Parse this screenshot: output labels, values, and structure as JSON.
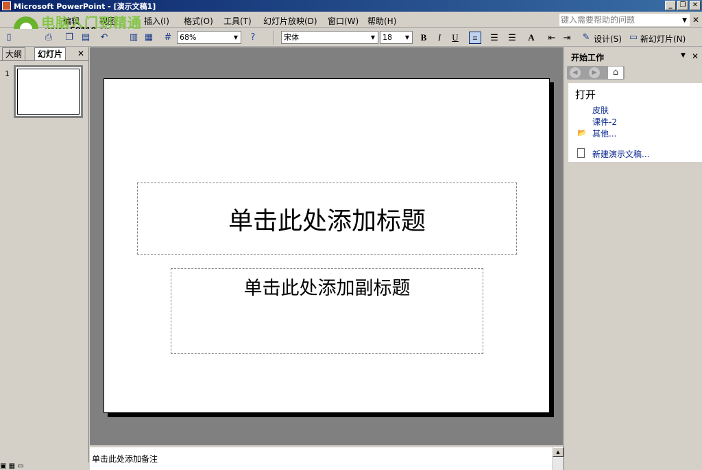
{
  "window": {
    "title": "Microsoft PowerPoint - [演示文稿1]"
  },
  "watermark": {
    "brand_cn": "电脑入门到精通",
    "url": "www.58116.cn"
  },
  "menubar": {
    "items": [
      {
        "label": "编辑"
      },
      {
        "label": "视图"
      },
      {
        "label": "插入(I)"
      },
      {
        "label": "格式(O)"
      },
      {
        "label": "工具(T)"
      },
      {
        "label": "幻灯片放映(D)"
      },
      {
        "label": "窗口(W)"
      },
      {
        "label": "帮助(H)"
      }
    ],
    "help_placeholder": "键入需要帮助的问题"
  },
  "toolbar": {
    "zoom": "68%",
    "font_name": "宋体",
    "font_size": "18",
    "bold": "B",
    "italic": "I",
    "underline": "U",
    "font_grow": "A",
    "design_label": "设计(S)",
    "new_slide_label": "新幻灯片(N)"
  },
  "left_pane": {
    "tab_outline": "大纲",
    "tab_slides": "幻灯片",
    "slide_number": "1"
  },
  "slide": {
    "title_placeholder": "单击此处添加标题",
    "subtitle_placeholder": "单击此处添加副标题"
  },
  "notes": {
    "placeholder": "单击此处添加备注"
  },
  "task_pane": {
    "title": "开始工作",
    "open_section": "打开",
    "files": [
      {
        "label": "皮肤"
      },
      {
        "label": "课件-2"
      }
    ],
    "more_label": "其他...",
    "new_presentation_label": "新建演示文稿..."
  }
}
